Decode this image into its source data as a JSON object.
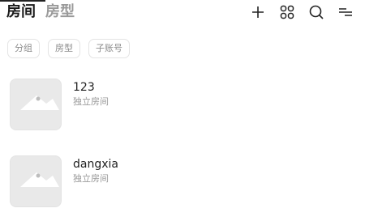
{
  "header": {
    "tabs": [
      {
        "label": "房间",
        "active": true
      },
      {
        "label": "房型",
        "active": false
      }
    ],
    "actions": [
      {
        "icon": "plus-icon"
      },
      {
        "icon": "grid-icon"
      },
      {
        "icon": "search-icon"
      },
      {
        "icon": "menu-icon"
      }
    ]
  },
  "filters": [
    {
      "label": "分组"
    },
    {
      "label": "房型"
    },
    {
      "label": "子账号"
    }
  ],
  "rooms": [
    {
      "name": "123",
      "type": "独立房间",
      "thumbnail_icon": "image-placeholder-icon"
    },
    {
      "name": "dangxia",
      "type": "独立房间",
      "thumbnail_icon": "image-placeholder-icon"
    }
  ],
  "colors": {
    "primary_text": "#222222",
    "muted_text": "#9a9a9a",
    "chip_border": "#e4e4e4",
    "thumb_bg": "#e9e9e9"
  }
}
